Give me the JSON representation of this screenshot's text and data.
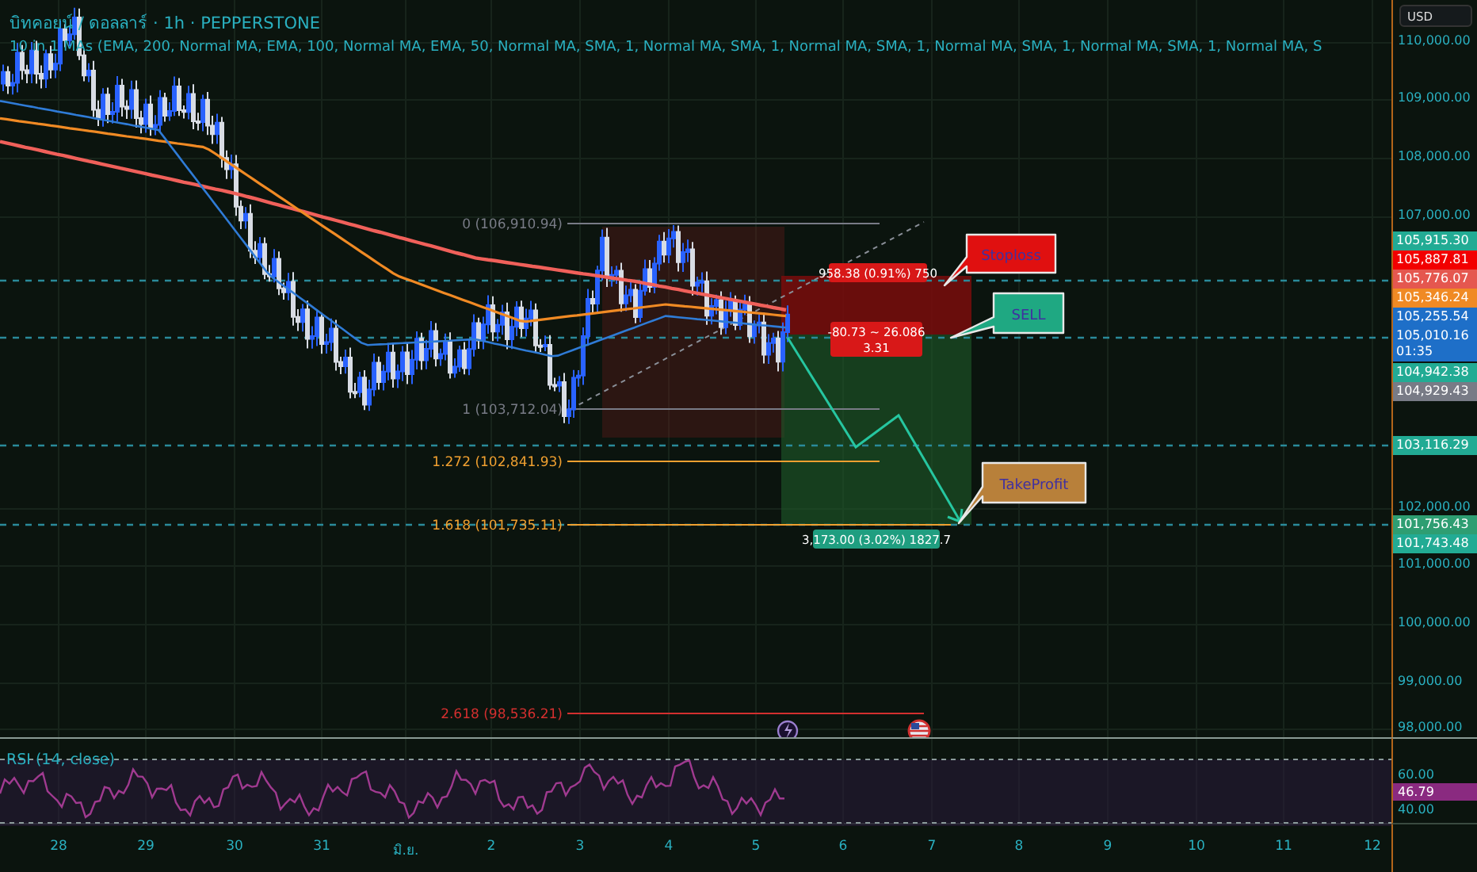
{
  "header": {
    "symbol_title": "บิทคอยน์ / ดอลลาร์ · 1h · PEPPERSTONE",
    "indicator_title": "10 in 1 MAs (EMA, 200, Normal MA, EMA, 100, Normal MA, EMA, 50, Normal MA, SMA, 1, Normal MA, SMA, 1, Normal MA, SMA, 1, Normal MA, SMA, 1, Normal MA, SMA, 1, Normal MA, S"
  },
  "currency_button": "USD",
  "price_axis": [
    "110,000.00",
    "109,000.00",
    "108,000.00",
    "107,000.00",
    "102,000.00",
    "101,000.00",
    "100,000.00",
    "99,000.00",
    "98,000.00"
  ],
  "price_tags": [
    {
      "text": "105,915.30",
      "color": "#22ab94"
    },
    {
      "text": "105,887.81",
      "color": "#f20000"
    },
    {
      "text": "105,776.07",
      "color": "#e5574f"
    },
    {
      "text": "105,346.24",
      "color": "#f08a24"
    },
    {
      "text": "105,255.54",
      "color": "#1e6fc8"
    },
    {
      "text": "105,010.16",
      "subtext": "01:35",
      "color": "#1e6fc8"
    },
    {
      "text": "104,942.38",
      "color": "#22ab94"
    },
    {
      "text": "104,929.43",
      "color": "#787b86"
    },
    {
      "text": "103,116.29",
      "color": "#22ab94"
    },
    {
      "text": "101,756.43",
      "color": "#2e9e72"
    },
    {
      "text": "101,743.48",
      "color": "#22ab94"
    }
  ],
  "fib_levels": [
    {
      "text": "0 (106,910.94)",
      "color": "#787b86"
    },
    {
      "text": "1 (103,712.04)",
      "color": "#787b86"
    },
    {
      "text": "1.272 (102,841.93)",
      "color": "#f0a030"
    },
    {
      "text": "1.618 (101,735.11)",
      "color": "#f0a030"
    },
    {
      "text": "2.618 (98,536.21)",
      "color": "#d32f2f"
    }
  ],
  "position_labels": [
    {
      "kind": "stop",
      "lines": [
        "958.38 (0.91%) 750"
      ]
    },
    {
      "kind": "entry",
      "lines": [
        "-80.73 ~ 26.086",
        "3.31"
      ]
    },
    {
      "kind": "target",
      "lines": [
        "3,173.00 (3.02%) 1827.7"
      ]
    }
  ],
  "callouts": [
    {
      "text": "Stoploss",
      "color": "#e01010"
    },
    {
      "text": "SELL",
      "color": "#1fa882"
    },
    {
      "text": "TakeProfit",
      "color": "#b8803a"
    }
  ],
  "rsi": {
    "title": "RSI (14, close)",
    "axis_labels": [
      "60.00",
      "40.00"
    ],
    "value": "46.79"
  },
  "time_axis": [
    "28",
    "29",
    "30",
    "31",
    "มิ.ย.",
    "2",
    "3",
    "4",
    "5",
    "6",
    "7",
    "8",
    "9",
    "10",
    "11",
    "12"
  ]
}
